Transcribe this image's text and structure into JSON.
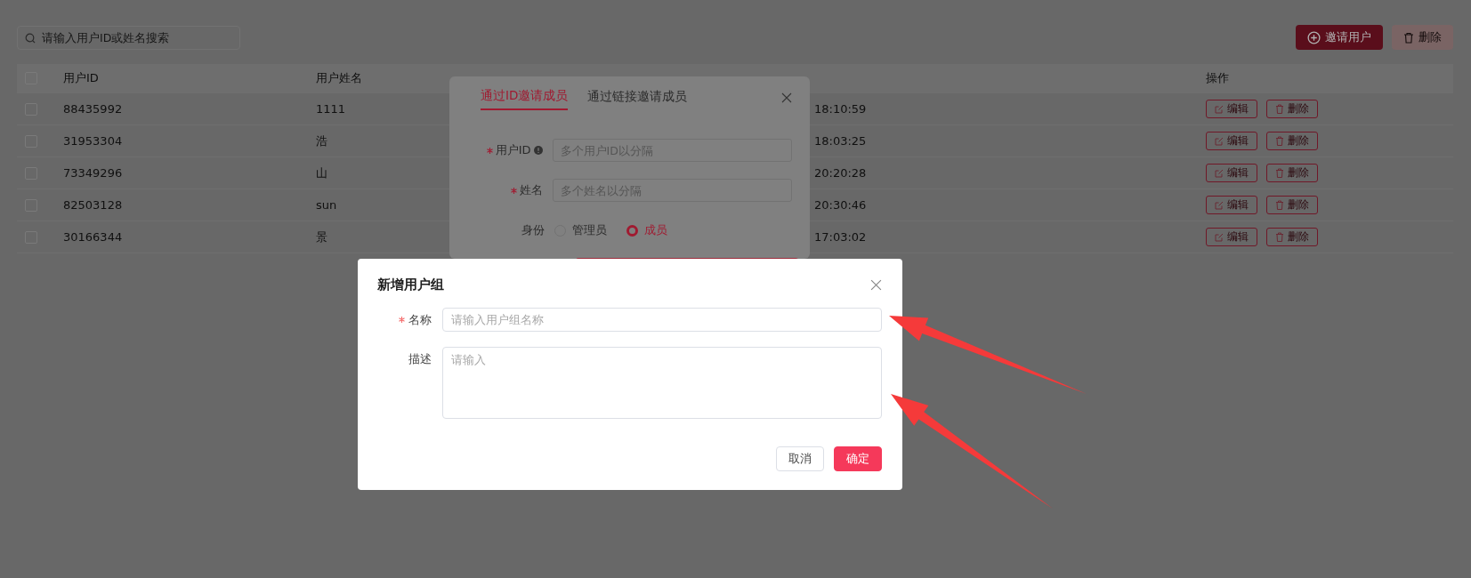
{
  "toolbar": {
    "search": {
      "placeholder": "请输入用户ID或姓名搜索"
    },
    "buttons": [
      {
        "label": "邀请用户",
        "kind": "primary",
        "disabled": false
      },
      {
        "label": "删除",
        "kind": "danger",
        "disabled": true
      }
    ]
  },
  "table": {
    "select_all_checked": false,
    "columns": [
      "用户ID",
      "用户姓名",
      "操作"
    ],
    "rows": [
      {
        "checked": false,
        "user_id": "88435992",
        "user_name": "1111",
        "column_3": "18:10:59",
        "actions": [
          "编辑",
          "删除"
        ]
      },
      {
        "checked": false,
        "user_id": "31953304",
        "user_name": "浩",
        "column_3": "18:03:25",
        "actions": [
          "编辑",
          "删除"
        ]
      },
      {
        "checked": false,
        "user_id": "73349296",
        "user_name": "山",
        "column_3": "20:20:28",
        "actions": [
          "编辑",
          "删除"
        ]
      },
      {
        "checked": false,
        "user_id": "82503128",
        "user_name": "sun",
        "column_3": "20:30:46",
        "actions": [
          "编辑",
          "删除"
        ]
      },
      {
        "checked": false,
        "user_id": "30166344",
        "user_name": "景",
        "column_3": "17:03:02",
        "actions": [
          "编辑",
          "删除"
        ]
      }
    ]
  },
  "invite_dialog": {
    "tabs": [
      {
        "label": "通过ID邀请成员",
        "selected": true
      },
      {
        "label": "通过链接邀请成员",
        "selected": false
      }
    ],
    "fields": [
      {
        "label": "用户ID",
        "required": true,
        "info": true,
        "placeholder": "多个用户ID以分隔"
      },
      {
        "label": "姓名",
        "required": true,
        "info": false,
        "placeholder": "多个姓名以分隔"
      }
    ],
    "role": {
      "label": "身份",
      "options": [
        {
          "label": "管理员",
          "selected": false
        },
        {
          "label": "成员",
          "selected": true
        }
      ]
    }
  },
  "group_dialog": {
    "title": "新增用户组",
    "fields": [
      {
        "label": "名称",
        "required": true,
        "kind": "input",
        "placeholder": "请输入用户组名称"
      },
      {
        "label": "描述",
        "required": false,
        "kind": "textarea",
        "placeholder": "请输入"
      }
    ],
    "buttons": [
      {
        "label": "取消",
        "kind": "default"
      },
      {
        "label": "确定",
        "kind": "primary"
      }
    ]
  },
  "annotations": [
    {
      "kind": "arrow"
    },
    {
      "kind": "arrow"
    }
  ]
}
